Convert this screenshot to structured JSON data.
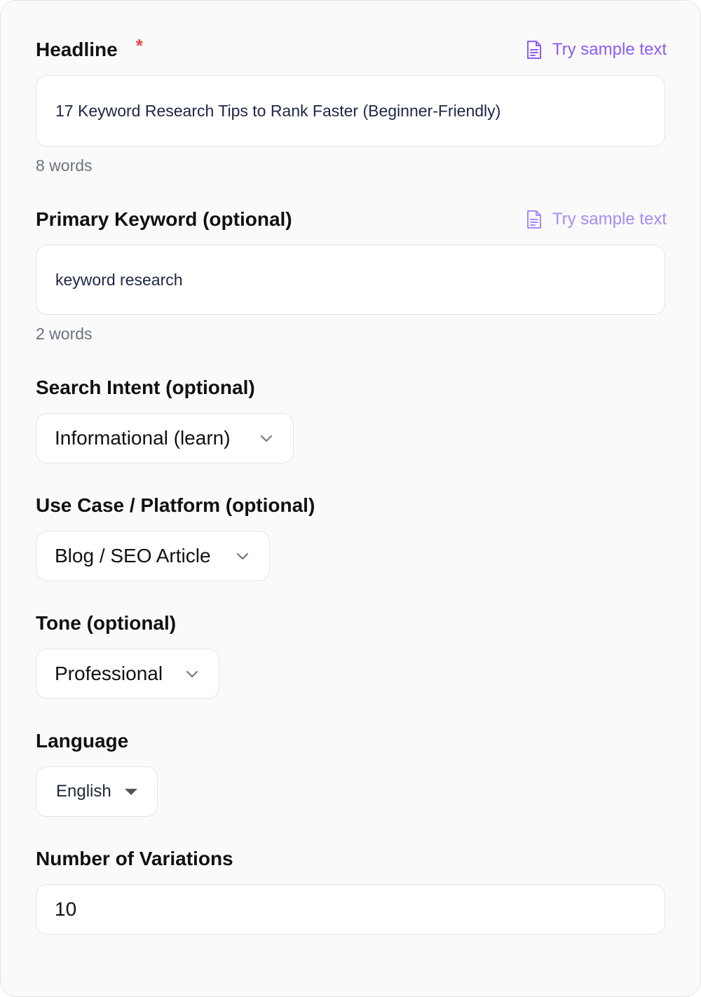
{
  "headline": {
    "label": "Headline",
    "required_mark": "*",
    "sample_link": "Try sample text",
    "value": "17 Keyword Research Tips to Rank Faster (Beginner-Friendly)",
    "word_count": "8 words"
  },
  "primary_keyword": {
    "label": "Primary Keyword (optional)",
    "sample_link": "Try sample text",
    "value": "keyword research",
    "word_count": "2 words"
  },
  "search_intent": {
    "label": "Search Intent (optional)",
    "selected": "Informational (learn)"
  },
  "use_case": {
    "label": "Use Case / Platform (optional)",
    "selected": "Blog / SEO Article"
  },
  "tone": {
    "label": "Tone (optional)",
    "selected": "Professional"
  },
  "language": {
    "label": "Language",
    "selected": "English"
  },
  "variations": {
    "label": "Number of Variations",
    "value": "10"
  },
  "colors": {
    "accent": "#8b5cf6",
    "required": "#ef4444",
    "border": "#e4e4e7"
  }
}
